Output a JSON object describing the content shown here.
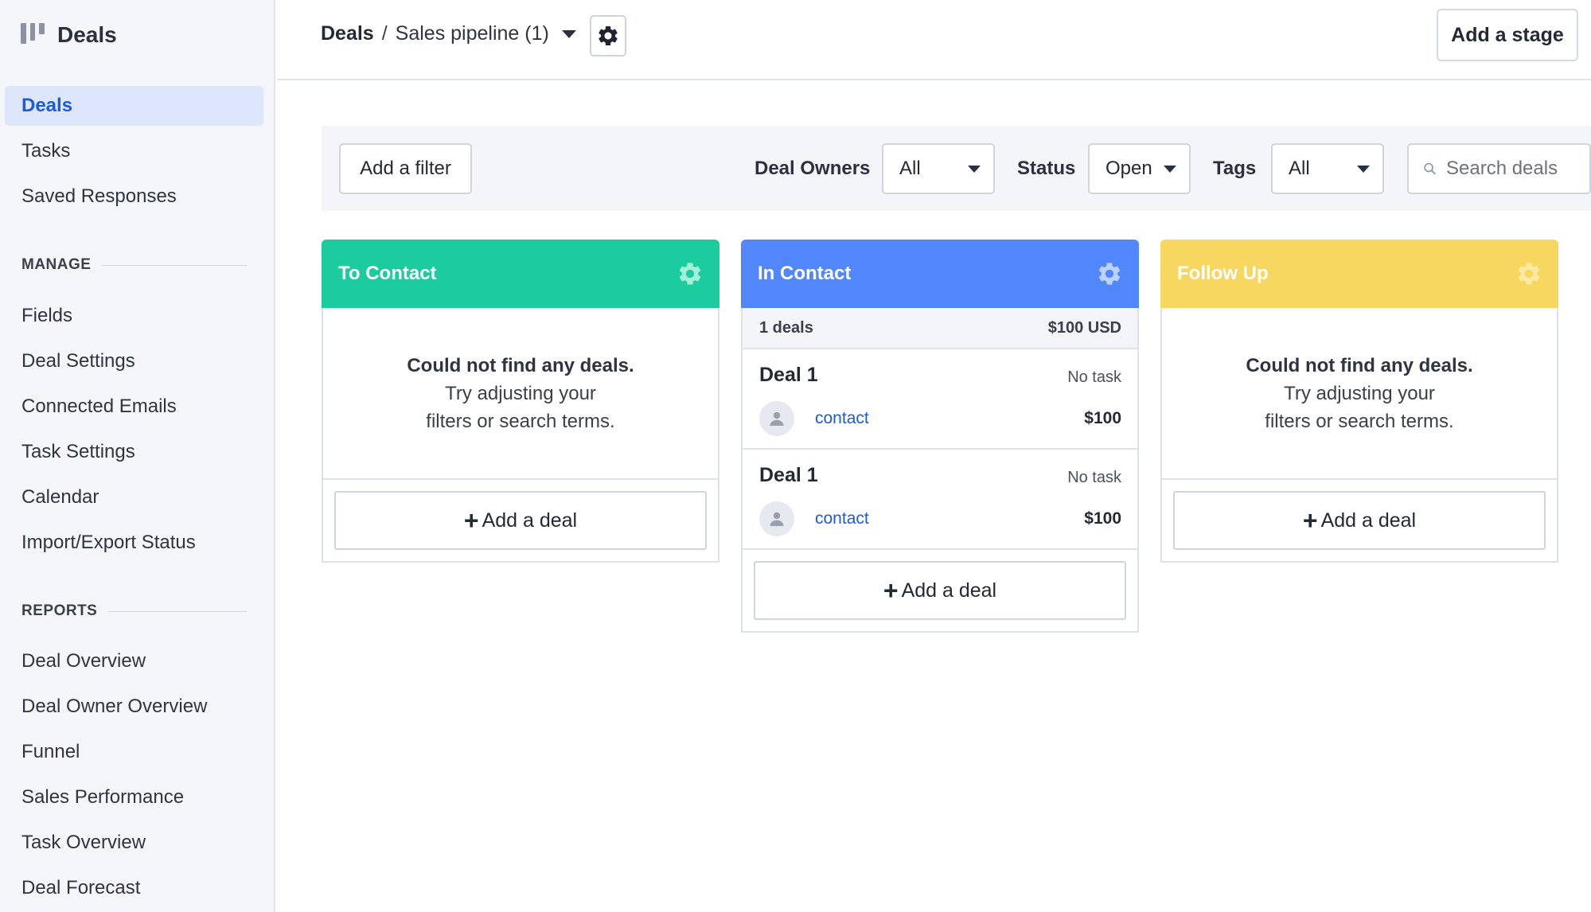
{
  "app": {
    "title": "Deals"
  },
  "sidebar": {
    "items": [
      {
        "label": "Deals",
        "active": true
      },
      {
        "label": "Tasks"
      },
      {
        "label": "Saved Responses"
      }
    ],
    "manage": {
      "heading": "MANAGE",
      "items": [
        "Fields",
        "Deal Settings",
        "Connected Emails",
        "Task Settings",
        "Calendar",
        "Import/Export Status"
      ]
    },
    "reports": {
      "heading": "REPORTS",
      "items": [
        "Deal Overview",
        "Deal Owner Overview",
        "Funnel",
        "Sales Performance",
        "Task Overview",
        "Deal Forecast"
      ]
    }
  },
  "header": {
    "breadcrumb_root": "Deals",
    "breadcrumb_sep": "/",
    "pipeline": "Sales pipeline (1)",
    "add_stage": "Add a stage"
  },
  "filters": {
    "add_filter": "Add a filter",
    "deal_owners_label": "Deal Owners",
    "deal_owners_value": "All",
    "status_label": "Status",
    "status_value": "Open",
    "tags_label": "Tags",
    "tags_value": "All",
    "search_placeholder": "Search deals"
  },
  "columns": [
    {
      "title": "To Contact",
      "color": "#1dcc9e",
      "empty_title": "Could not find any deals.",
      "empty_line1": "Try adjusting your",
      "empty_line2": "filters or search terms.",
      "add_label": "Add a deal"
    },
    {
      "title": "In Contact",
      "color": "#5287fb",
      "summary_count": "1 deals",
      "summary_total": "$100 USD",
      "deals": [
        {
          "name": "Deal 1",
          "task": "No task",
          "contact": "contact",
          "amount": "$100"
        },
        {
          "name": "Deal 1",
          "task": "No task",
          "contact": "contact",
          "amount": "$100"
        }
      ],
      "add_label": "Add a deal"
    },
    {
      "title": "Follow Up",
      "color": "#f7d760",
      "empty_title": "Could not find any deals.",
      "empty_line1": "Try adjusting your",
      "empty_line2": "filters or search terms.",
      "add_label": "Add a deal"
    }
  ],
  "icons": {
    "brand": "kanban-icon",
    "settings": "gear-icon",
    "search": "search-icon",
    "avatar": "person-icon",
    "add": "plus-icon",
    "caret": "caret-down-icon"
  }
}
